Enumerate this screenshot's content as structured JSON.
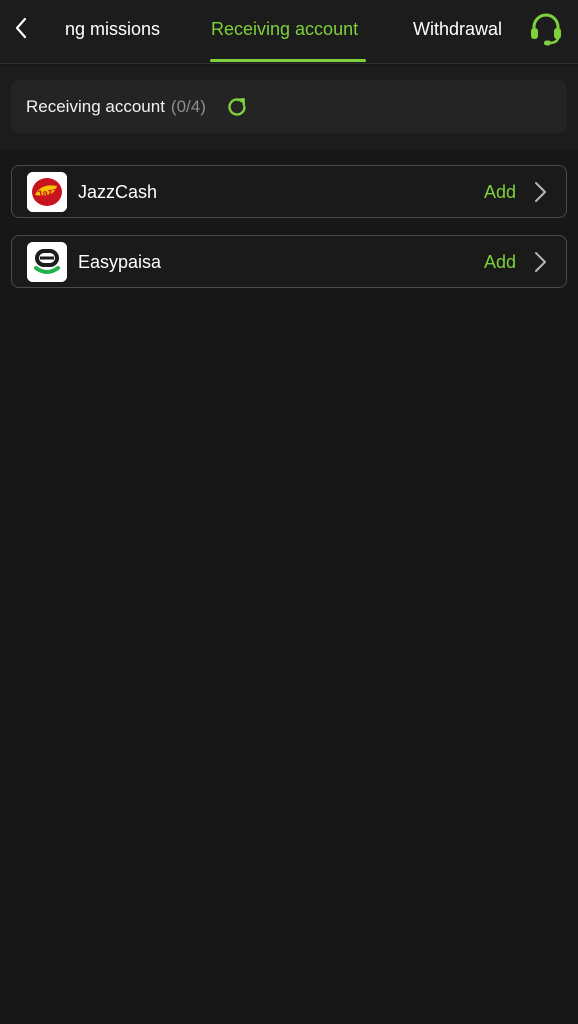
{
  "header": {
    "tabs": [
      {
        "label": "ng missions"
      },
      {
        "label": "Receiving account"
      },
      {
        "label": "Withdrawal"
      }
    ],
    "active_tab_index": 1
  },
  "summary": {
    "label": "Receiving account",
    "count": "(0/4)"
  },
  "methods": [
    {
      "name": "JazzCash",
      "action": "Add",
      "logo_icon": "jazzcash-logo"
    },
    {
      "name": "Easypaisa",
      "action": "Add",
      "logo_icon": "easypaisa-logo"
    }
  ],
  "colors": {
    "accent": "#7ed13a",
    "background": "#171717",
    "card": "#242424",
    "border": "#4a4a4a",
    "muted_text": "#8e8e8e"
  },
  "icons": {
    "back": "chevron-left-icon",
    "support": "headset-icon",
    "refresh": "refresh-icon",
    "row_arrow": "chevron-right-icon"
  }
}
